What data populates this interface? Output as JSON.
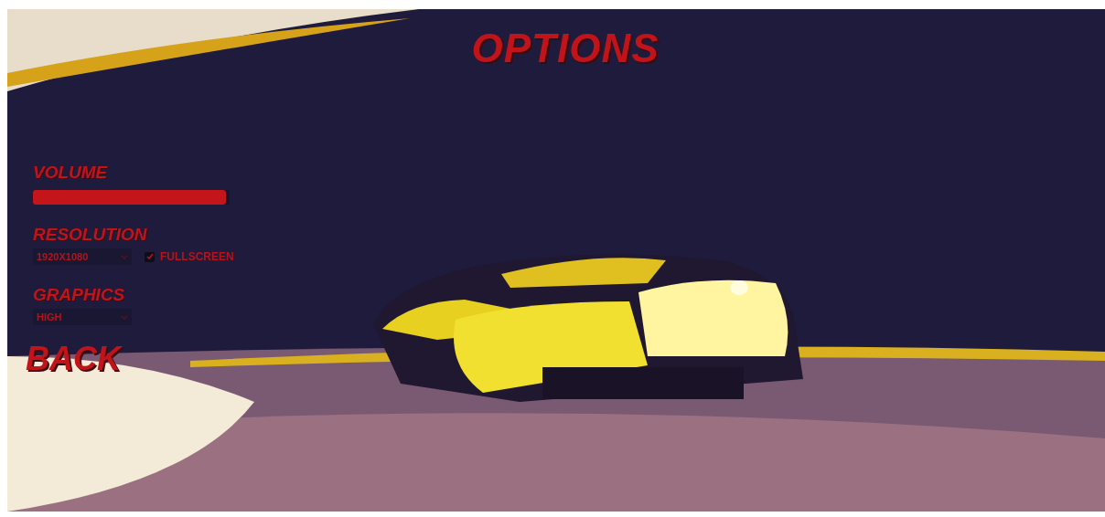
{
  "title": "OPTIONS",
  "volume": {
    "label": "VOLUME",
    "level": 0.98
  },
  "resolution": {
    "label": "RESOLUTION",
    "value": "1920X1080",
    "fullscreen": {
      "label": "FULLSCREEN",
      "checked": true
    }
  },
  "graphics": {
    "label": "GRAPHICS",
    "value": "HIGH"
  },
  "back": "BACK"
}
